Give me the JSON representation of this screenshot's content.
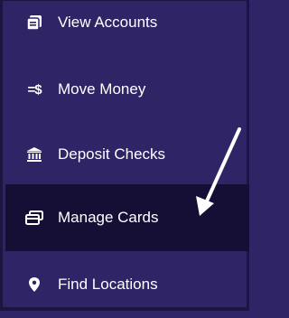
{
  "nav": {
    "items": [
      {
        "label": "View Accounts",
        "icon": "accounts-icon"
      },
      {
        "label": "Move Money",
        "icon": "move-money-icon",
        "glyph": "=$"
      },
      {
        "label": "Deposit Checks",
        "icon": "bank-icon"
      },
      {
        "label": "Manage Cards",
        "icon": "cards-icon",
        "active": true
      },
      {
        "label": "Find Locations",
        "icon": "location-pin-icon"
      }
    ]
  },
  "colors": {
    "background": "#2e2466",
    "active_background": "#160f35",
    "text": "#ffffff",
    "annotation_arrow": "#ffffff"
  },
  "annotation": {
    "icon": "arrow-icon",
    "target": "Manage Cards"
  }
}
